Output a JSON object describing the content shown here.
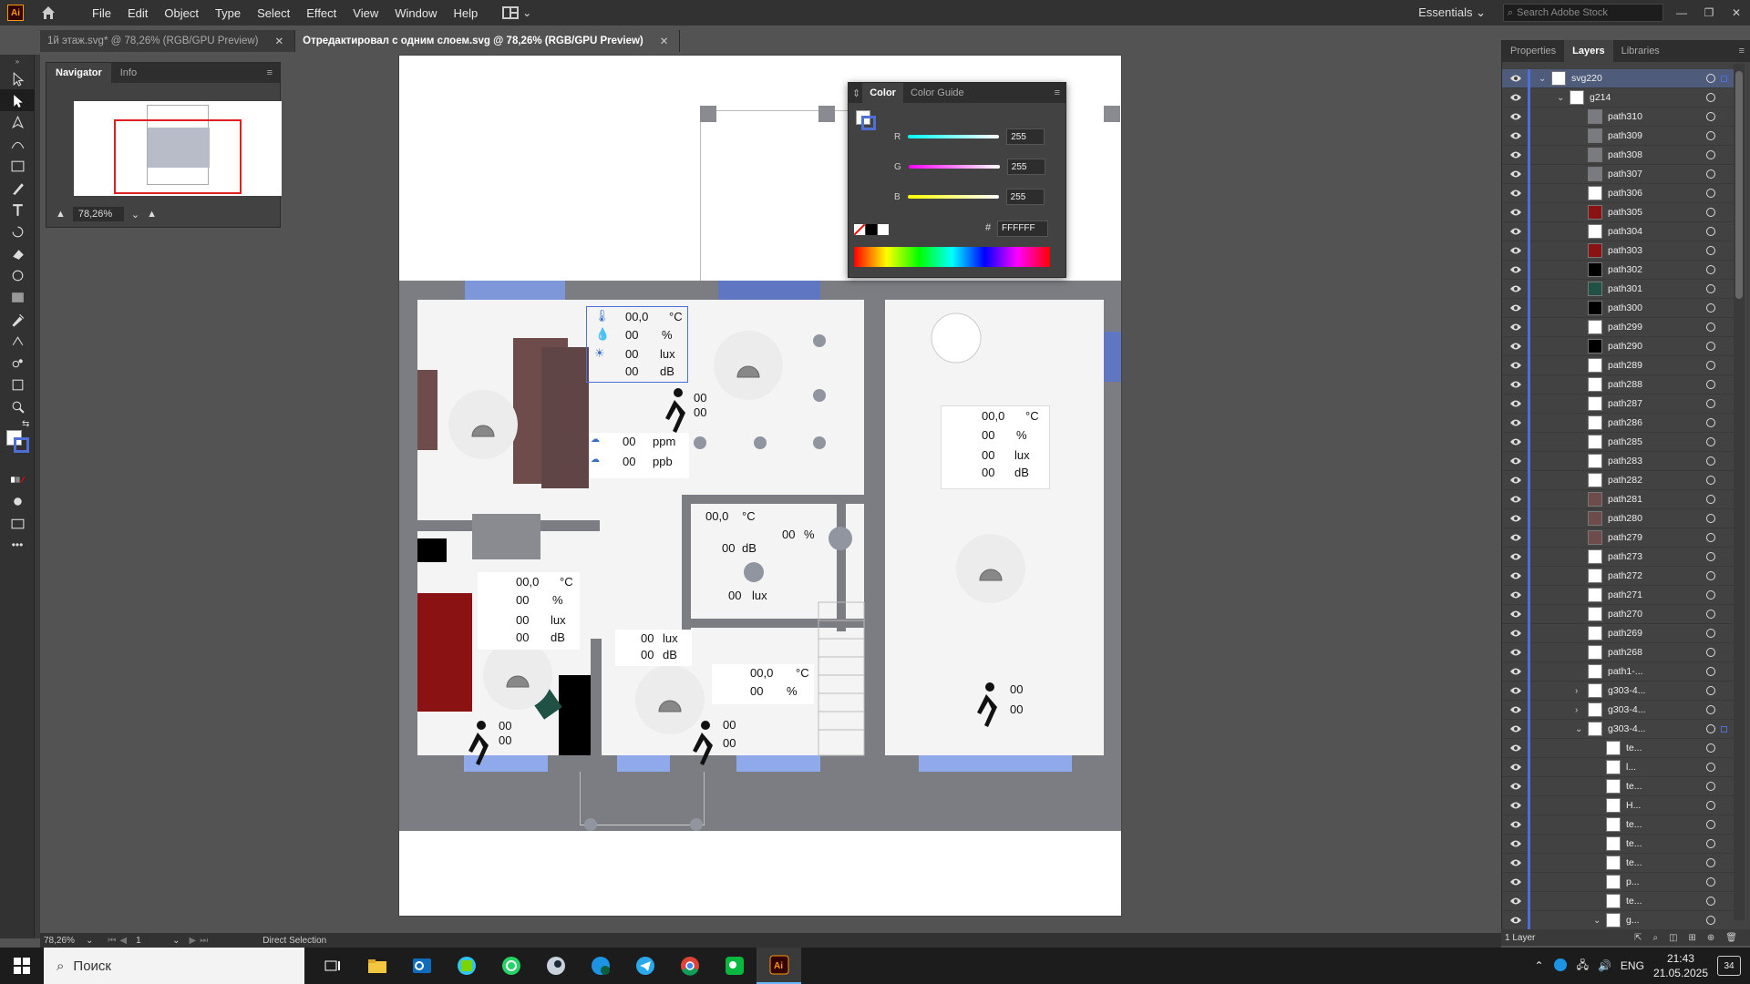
{
  "app": {
    "logo": "Ai",
    "home_icon": "home-icon"
  },
  "menu": [
    "File",
    "Edit",
    "Object",
    "Type",
    "Select",
    "Effect",
    "View",
    "Window",
    "Help"
  ],
  "workspace": "Essentials",
  "search_placeholder": "Search Adobe Stock",
  "tabs": [
    {
      "label": "1й этаж.svg* @ 78,26% (RGB/GPU Preview)",
      "active": false
    },
    {
      "label": "Отредактировал с одним слоем.svg @ 78,26% (RGB/GPU Preview)",
      "active": true
    }
  ],
  "navigator": {
    "tab1": "Navigator",
    "tab2": "Info",
    "zoom": "78,26%"
  },
  "color_panel": {
    "tab1": "Color",
    "tab2": "Color Guide",
    "r_label": "R",
    "g_label": "G",
    "b_label": "B",
    "r": "255",
    "g": "255",
    "b": "255",
    "hash": "#",
    "hex": "FFFFFF"
  },
  "right_tabs": [
    "Properties",
    "Layers",
    "Libraries"
  ],
  "layers": [
    {
      "name": "svg220",
      "indent": 0,
      "exp": "open",
      "sel": true
    },
    {
      "name": "g214",
      "indent": 1,
      "exp": "open",
      "sel": false
    },
    {
      "name": "path310",
      "indent": 2
    },
    {
      "name": "path309",
      "indent": 2
    },
    {
      "name": "path308",
      "indent": 2
    },
    {
      "name": "path307",
      "indent": 2
    },
    {
      "name": "path306",
      "indent": 2
    },
    {
      "name": "path305",
      "indent": 2
    },
    {
      "name": "path304",
      "indent": 2
    },
    {
      "name": "path303",
      "indent": 2
    },
    {
      "name": "path302",
      "indent": 2
    },
    {
      "name": "path301",
      "indent": 2
    },
    {
      "name": "path300",
      "indent": 2
    },
    {
      "name": "path299",
      "indent": 2
    },
    {
      "name": "path290",
      "indent": 2
    },
    {
      "name": "path289",
      "indent": 2
    },
    {
      "name": "path288",
      "indent": 2
    },
    {
      "name": "path287",
      "indent": 2
    },
    {
      "name": "path286",
      "indent": 2
    },
    {
      "name": "path285",
      "indent": 2
    },
    {
      "name": "path283",
      "indent": 2
    },
    {
      "name": "path282",
      "indent": 2
    },
    {
      "name": "path281",
      "indent": 2
    },
    {
      "name": "path280",
      "indent": 2
    },
    {
      "name": "path279",
      "indent": 2
    },
    {
      "name": "path273",
      "indent": 2
    },
    {
      "name": "path272",
      "indent": 2
    },
    {
      "name": "path271",
      "indent": 2
    },
    {
      "name": "path270",
      "indent": 2
    },
    {
      "name": "path269",
      "indent": 2
    },
    {
      "name": "path268",
      "indent": 2
    },
    {
      "name": "path1-...",
      "indent": 2
    },
    {
      "name": "g303-4...",
      "indent": 2,
      "exp": "closed"
    },
    {
      "name": "g303-4...",
      "indent": 2,
      "exp": "closed"
    },
    {
      "name": "g303-4...",
      "indent": 2,
      "exp": "open",
      "sel": true
    },
    {
      "name": "te...",
      "indent": 3
    },
    {
      "name": "l...",
      "indent": 3
    },
    {
      "name": "te...",
      "indent": 3
    },
    {
      "name": "H...",
      "indent": 3
    },
    {
      "name": "te...",
      "indent": 3
    },
    {
      "name": "te...",
      "indent": 3
    },
    {
      "name": "te...",
      "indent": 3
    },
    {
      "name": "p...",
      "indent": 3
    },
    {
      "name": "te...",
      "indent": 3
    },
    {
      "name": "g...",
      "indent": 3,
      "exp": "open"
    }
  ],
  "layers_footer": "1 Layer",
  "status": {
    "zoom": "78,26%",
    "page": "1",
    "mode": "Direct Selection"
  },
  "plan": {
    "s1": {
      "t": "00,0",
      "tu": "°C",
      "h": "00",
      "hu": "%",
      "l": "00",
      "lu": "lux",
      "d": "00",
      "du": "dB"
    },
    "s1b": {
      "a": "00",
      "b": "00"
    },
    "gas": {
      "c": "00",
      "cu": "ppm",
      "v": "00",
      "vu": "ppb"
    },
    "s2": {
      "t": "00,0",
      "tu": "°C",
      "h": "00",
      "hu": "%",
      "l": "00",
      "lu": "lux",
      "d": "00",
      "du": "dB"
    },
    "s3": {
      "t": "00,0",
      "tu": "°C",
      "d": "00",
      "du": "dB",
      "l": "00",
      "lu": "lux",
      "h": "00",
      "hu": "%"
    },
    "s4": {
      "l": "00",
      "lu": "lux",
      "d": "00",
      "du": "dB"
    },
    "s5": {
      "t": "00,0",
      "tu": "°C",
      "h": "00",
      "hu": "%"
    },
    "s6": {
      "t": "00,0",
      "tu": "°C",
      "h": "00",
      "hu": "%",
      "l": "00",
      "lu": "lux",
      "d": "00",
      "du": "dB"
    },
    "p1": {
      "a": "00",
      "b": "00"
    },
    "p2": {
      "a": "00",
      "b": "00"
    },
    "p3": {
      "a": "00",
      "b": "00"
    }
  },
  "taskbar": {
    "search": "Поиск",
    "lang": "ENG",
    "time": "21:43",
    "date": "21.05.2025",
    "notif": "34"
  }
}
